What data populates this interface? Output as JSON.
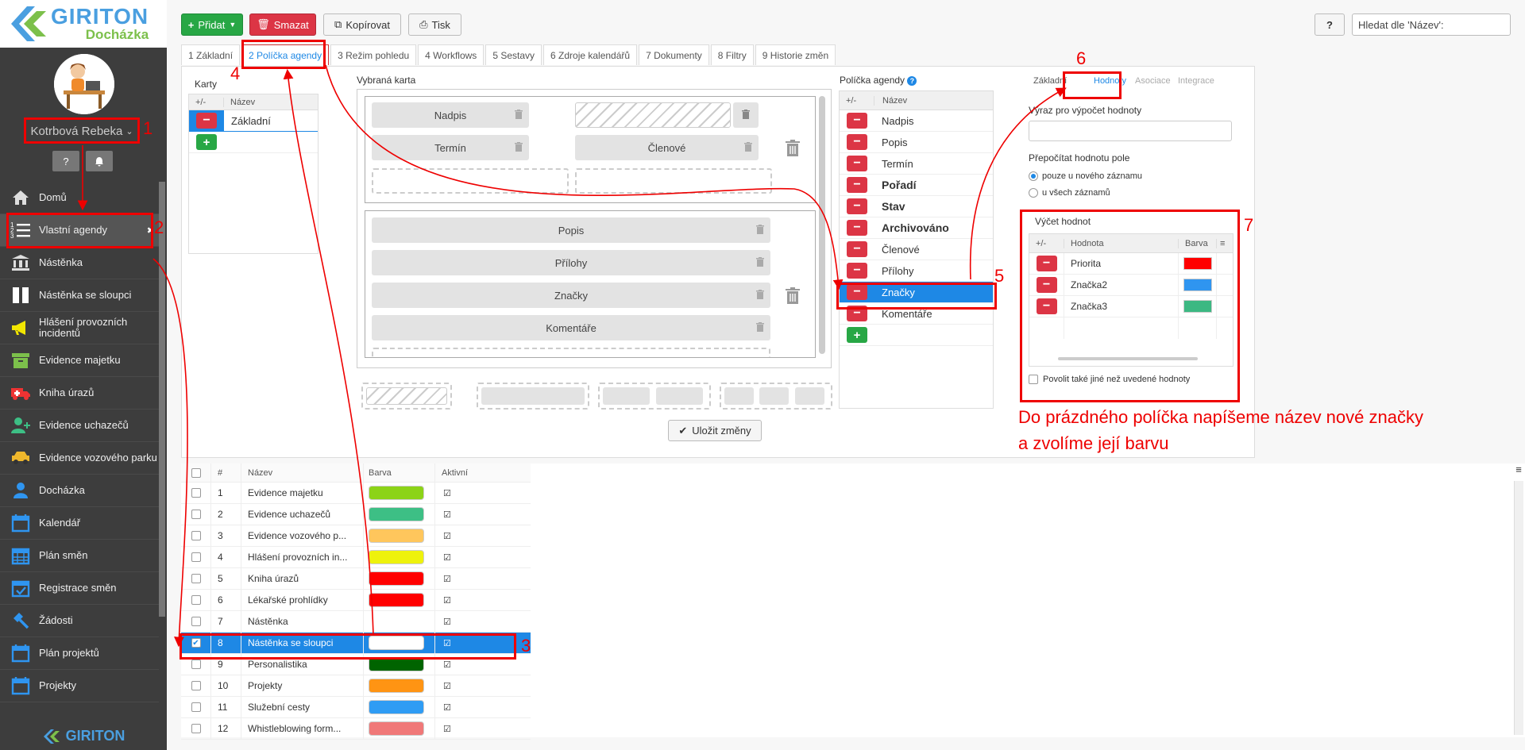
{
  "brand": {
    "name": "GIRITON",
    "product": "Docházka",
    "footer": "GIRITON"
  },
  "user": {
    "name": "Kotrbová Rebeka"
  },
  "menu": [
    {
      "label": "Domů",
      "icon": "home-icon"
    },
    {
      "label": "Vlastní agendy",
      "icon": "list-icon"
    },
    {
      "label": "Nástěnka",
      "icon": "bank-icon"
    },
    {
      "label": "Nástěnka se sloupci",
      "icon": "columns-icon"
    },
    {
      "label": "Hlášení provozních incidentů",
      "icon": "megaphone-icon"
    },
    {
      "label": "Evidence majetku",
      "icon": "box-icon"
    },
    {
      "label": "Kniha úrazů",
      "icon": "ambulance-icon"
    },
    {
      "label": "Evidence uchazečů",
      "icon": "user-plus-icon"
    },
    {
      "label": "Evidence vozového parku",
      "icon": "car-icon"
    },
    {
      "label": "Docházka",
      "icon": "user-icon"
    },
    {
      "label": "Kalendář",
      "icon": "calendar-icon"
    },
    {
      "label": "Plán směn",
      "icon": "calendar-grid-icon"
    },
    {
      "label": "Registrace směn",
      "icon": "calendar-check-icon"
    },
    {
      "label": "Žádosti",
      "icon": "gavel-icon"
    },
    {
      "label": "Plán projektů",
      "icon": "calendar-icon"
    },
    {
      "label": "Projekty",
      "icon": "calendar-icon"
    }
  ],
  "toolbar": {
    "add": "Přidat",
    "delete": "Smazat",
    "copy": "Kopírovat",
    "print": "Tisk",
    "help": "?",
    "search_value": "Hledat dle 'Název':"
  },
  "tabs": [
    "1 Základní",
    "2 Políčka agendy",
    "3 Režim pohledu",
    "4 Workflows",
    "5 Sestavy",
    "6 Zdroje kalendářů",
    "7 Dokumenty",
    "8 Filtry",
    "9 Historie změn"
  ],
  "cards": {
    "title": "Karty",
    "col_pm": "+/-",
    "col_name": "Název",
    "rows": [
      "Základní"
    ]
  },
  "selected_card": {
    "title": "Vybraná karta",
    "group1": [
      "Nadpis",
      "Termín",
      "Členové"
    ],
    "group2": [
      "Popis",
      "Přílohy",
      "Značky",
      "Komentáře"
    ]
  },
  "fields": {
    "title": "Políčka agendy",
    "help": "?",
    "col_pm": "+/-",
    "col_name": "Název",
    "rows": [
      {
        "name": "Nadpis",
        "bold": false
      },
      {
        "name": "Popis",
        "bold": false
      },
      {
        "name": "Termín",
        "bold": false
      },
      {
        "name": "Pořadí",
        "bold": true
      },
      {
        "name": "Stav",
        "bold": true
      },
      {
        "name": "Archivováno",
        "bold": true
      },
      {
        "name": "Členové",
        "bold": false
      },
      {
        "name": "Přílohy",
        "bold": false
      },
      {
        "name": "Značky",
        "bold": false,
        "selected": true
      },
      {
        "name": "Komentáře",
        "bold": false
      }
    ]
  },
  "props": {
    "tabs": [
      "Základní",
      "Hodnoty",
      "Asociace",
      "Integrace"
    ],
    "expr_label": "Výraz pro výpočet hodnoty",
    "expr_value": "",
    "recalc_label": "Přepočítat hodnotu pole",
    "radio1": "pouze u nového záznamu",
    "radio2": "u všech záznamů",
    "enum_title": "Výčet hodnot",
    "col_pm": "+/-",
    "col_value": "Hodnota",
    "col_color": "Barva",
    "enum_rows": [
      {
        "value": "Priorita",
        "color": "#ff0000"
      },
      {
        "value": "Značka2",
        "color": "#2f95f0"
      },
      {
        "value": "Značka3",
        "color": "#3cb882"
      }
    ],
    "allow_other": "Povolit také jiné než uvedené hodnoty"
  },
  "save": "Uložit změny",
  "table": {
    "headers": [
      "#",
      "Název",
      "Barva",
      "Aktivní"
    ],
    "rows": [
      {
        "n": "1",
        "name": "Evidence majetku",
        "color": "#8cd317"
      },
      {
        "n": "2",
        "name": "Evidence uchazečů",
        "color": "#3dbf85"
      },
      {
        "n": "3",
        "name": "Evidence vozového p...",
        "color": "#ffc65c"
      },
      {
        "n": "4",
        "name": "Hlášení provozních in...",
        "color": "#eef20c"
      },
      {
        "n": "5",
        "name": "Kniha úrazů",
        "color": "#ff0000"
      },
      {
        "n": "6",
        "name": "Lékařské prohlídky",
        "color": "#ff0000"
      },
      {
        "n": "7",
        "name": "Nástěnka",
        "color": ""
      },
      {
        "n": "8",
        "name": "Nástěnka se sloupci",
        "color": "#ffffff",
        "selected": true
      },
      {
        "n": "9",
        "name": "Personalistika",
        "color": "#006400"
      },
      {
        "n": "10",
        "name": "Projekty",
        "color": "#ff9413"
      },
      {
        "n": "11",
        "name": "Služební cesty",
        "color": "#2f9cf4"
      },
      {
        "n": "12",
        "name": "Whistleblowing form...",
        "color": "#f07878"
      }
    ]
  },
  "annotations": {
    "n1": "1",
    "n2": "2",
    "n3": "3",
    "n4": "4",
    "n5": "5",
    "n6": "6",
    "n7": "7",
    "text_line1": "Do prázdného políčka napíšeme název nové značky",
    "text_line2": "a zvolíme její barvu"
  },
  "colors": {
    "accent": "#1e88e5",
    "danger": "#dc3545",
    "success": "#28a745",
    "annotation": "#ee0000",
    "sidebar": "#3d3d3d"
  }
}
